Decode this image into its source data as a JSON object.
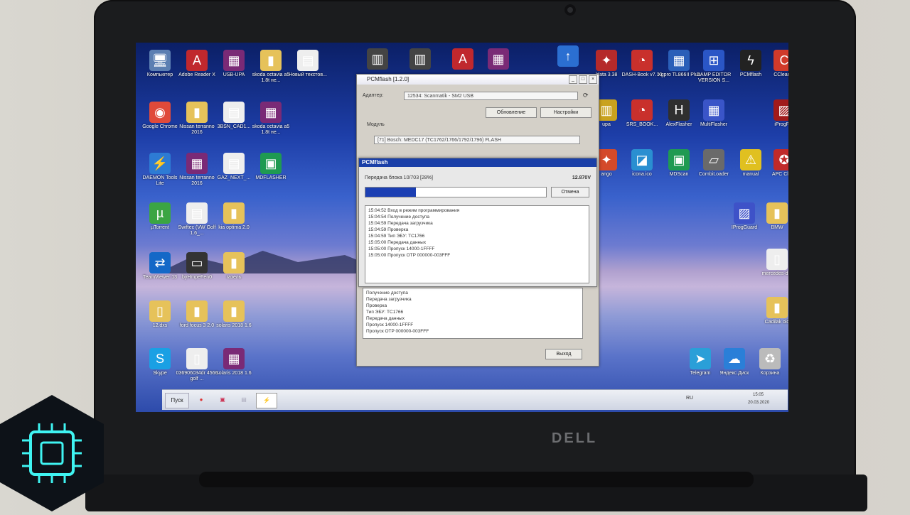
{
  "brand": "DELL",
  "desktop_icons": {
    "left": [
      {
        "label": "Компьютер",
        "icon": "computer-icon",
        "color": "#5c7fb2"
      },
      {
        "label": "Adobe Reader X",
        "icon": "pdf-icon",
        "color": "#c0282d"
      },
      {
        "label": "USB-UPA",
        "icon": "winrar-icon",
        "color": "#7a2a76"
      },
      {
        "label": "skoda octavia a5 1.8t не...",
        "icon": "folder-icon",
        "color": "#e6c25a"
      },
      {
        "label": "Новый текстов...",
        "icon": "document-icon",
        "color": "#eeeeee"
      },
      {
        "label": "Google Chrome",
        "icon": "chrome-icon",
        "color": "#e04a3a"
      },
      {
        "label": "Nissan terranno 2016",
        "icon": "folder-icon",
        "color": "#e6c25a"
      },
      {
        "label": "3BSN_CAD1...",
        "icon": "document-icon",
        "color": "#eeeeee"
      },
      {
        "label": "skoda octavia a5 1.8t не...",
        "icon": "winrar-icon",
        "color": "#7a2a76"
      },
      {
        "label": "DAEMON Tools Lite",
        "icon": "daemon-icon",
        "color": "#2d7bd4"
      },
      {
        "label": "Nissan terranno 2016",
        "icon": "winrar-icon",
        "color": "#7a2a76"
      },
      {
        "label": "GAZ_NEXT_...",
        "icon": "document-icon",
        "color": "#eeeeee"
      },
      {
        "label": "MDFLASHER",
        "icon": "circuit-icon",
        "color": "#1f9a52"
      },
      {
        "label": "µTorrent",
        "icon": "utorrent-icon",
        "color": "#3ba543"
      },
      {
        "label": "Swiftec (VW Golf 1.6_...",
        "icon": "document-icon",
        "color": "#eeeeee"
      },
      {
        "label": "kia optima 2.0",
        "icon": "folder-icon",
        "color": "#e6c25a"
      },
      {
        "label": "TeamViewer 13",
        "icon": "teamviewer-icon",
        "color": "#1468c7"
      },
      {
        "label": "byHmpeFen0",
        "icon": "device-icon",
        "color": "#333333"
      },
      {
        "label": "газель",
        "icon": "folder-icon",
        "color": "#e6c25a"
      },
      {
        "label": "12.dxs",
        "icon": "file-icon",
        "color": "#e6c25a"
      },
      {
        "label": "ford focus 3 2.0",
        "icon": "folder-icon",
        "color": "#e6c25a"
      },
      {
        "label": "solaris 2018 1.6",
        "icon": "folder-icon",
        "color": "#e6c25a"
      },
      {
        "label": "Skype",
        "icon": "skype-icon",
        "color": "#1aa0e4"
      },
      {
        "label": "036906034dr 4566 golf ...",
        "icon": "file-icon",
        "color": "#eeeeee"
      },
      {
        "label": "solaris 2018 1.6",
        "icon": "winrar-icon",
        "color": "#7a2a76"
      }
    ],
    "top_mid": [
      {
        "label": "",
        "icon": "chip-icon",
        "color": "#444444"
      },
      {
        "label": "",
        "icon": "chip-icon",
        "color": "#444444"
      },
      {
        "label": "",
        "icon": "pdf-icon",
        "color": "#c0282d"
      },
      {
        "label": "",
        "icon": "winrar-icon",
        "color": "#7a2a76"
      }
    ],
    "right": [
      {
        "label": "",
        "icon": "update-icon",
        "color": "#2b6fd1"
      },
      {
        "label": "ldata 3.38",
        "icon": "app-icon",
        "color": "#b52a2a"
      },
      {
        "label": "DASH-Book v7.10",
        "icon": "dashbook-icon",
        "color": "#c9302c"
      },
      {
        "label": "Xgpro TL866II Plus",
        "icon": "xgpro-icon",
        "color": "#2a5fb8"
      },
      {
        "label": "DAMP EDITOR VERSION S...",
        "icon": "editor-icon",
        "color": "#2a56c6"
      },
      {
        "label": "PCMflash",
        "icon": "pcmflash-icon",
        "color": "#222222"
      },
      {
        "label": "CCleaner",
        "icon": "ccleaner-icon",
        "color": "#d03a2a"
      },
      {
        "label": "upa",
        "icon": "upa-icon",
        "color": "#c9a21e"
      },
      {
        "label": "SRS_BOOK...",
        "icon": "srs-icon",
        "color": "#c9302c"
      },
      {
        "label": "AlexFlasher",
        "icon": "honda-icon",
        "color": "#2f2f2f"
      },
      {
        "label": "MultiFlasher",
        "icon": "multiflasher-icon",
        "color": "#3a55c8"
      },
      {
        "label": "iProgPro",
        "icon": "iprog-icon",
        "color": "#a11a1a"
      },
      {
        "label": "ango",
        "icon": "app-icon",
        "color": "#d44a2a"
      },
      {
        "label": "icona.ico",
        "icon": "image-icon",
        "color": "#2a8fd1"
      },
      {
        "label": "MDScan",
        "icon": "circuit-icon",
        "color": "#1f9a52"
      },
      {
        "label": "CombiLoader",
        "icon": "combi-icon",
        "color": "#6a6a6a"
      },
      {
        "label": "manual",
        "icon": "warning-icon",
        "color": "#e0c020"
      },
      {
        "label": "APC Client",
        "icon": "apc-icon",
        "color": "#c02a2a"
      },
      {
        "label": "IProgGuard",
        "icon": "iprog-icon",
        "color": "#3e52c8"
      },
      {
        "label": "BMW",
        "icon": "folder-icon",
        "color": "#e6c25a"
      },
      {
        "label": "mercedes-d...",
        "icon": "file-icon",
        "color": "#eeeeee"
      },
      {
        "label": "Cadilak old",
        "icon": "folder-icon",
        "color": "#e6c25a"
      },
      {
        "label": "Telegram",
        "icon": "telegram-icon",
        "color": "#2a9fd8"
      },
      {
        "label": "Яндекс.Диск",
        "icon": "yadisk-icon",
        "color": "#2a7fd8"
      },
      {
        "label": "Корзина",
        "icon": "recycle-icon",
        "color": "#bbbbbb"
      }
    ]
  },
  "pcmflash": {
    "title": "PCMflash [1.2.0]",
    "adapter_label": "Адаптер:",
    "adapter_value": "12534: Scanmatik - SM2 USB",
    "update_btn": "Обновление",
    "settings_btn": "Настройки",
    "module_group": "Модуль",
    "module_value": "[71] Bosch: MEDC17 (TC1762/1766/1792/1796) FLASH",
    "exit_btn": "Выход",
    "lower_log": [
      "Получение доступа",
      "Передача загрузчика",
      "Проверка",
      "Тип ЭБУ: TC1766",
      "Передача данных",
      "Пропуск 14000-1FFFF",
      "Пропуск OTP 000000-003FFF"
    ]
  },
  "progress": {
    "title": "PCMflash",
    "status": "Передача блока 10/703 [28%]",
    "voltage": "12.870V",
    "percent": 28,
    "cancel_btn": "Отмена",
    "log": [
      "15:04:52 Вход в режим программирования",
      "15:04:54 Получение доступа",
      "15:04:59 Передача загрузчика",
      "15:04:59 Проверка",
      "15:04:59 Тип ЭБУ: TC1766",
      "15:05:00 Передача данных",
      "15:05:00 Пропуск 14000-1FFFF",
      "15:05:00 Пропуск OTP 000000-003FFF"
    ]
  },
  "taskbar": {
    "start": "Пуск",
    "lang": "RU",
    "time": "15:05",
    "date": "20.03.2020"
  }
}
